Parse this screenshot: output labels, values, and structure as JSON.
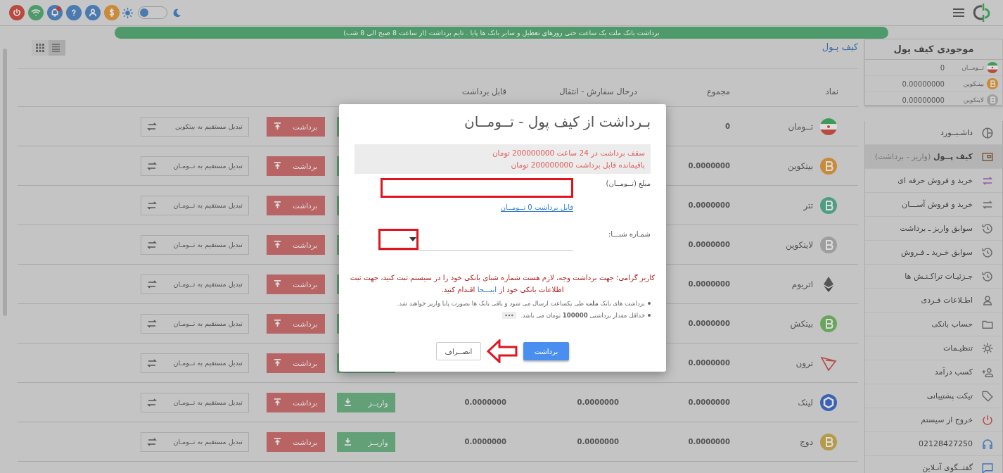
{
  "header": {
    "banner": "برداشت بانک ملت یک ساعت حتی روزهای تعطیل و سایر بانک ها پایا . تایم برداشت (از ساعت 8 صبح الی 8 شب)",
    "theme_switch": {
      "on": false
    }
  },
  "wallet_balance": {
    "title": "موجودی کیف پول",
    "rows": [
      {
        "name": "تــومــان",
        "amount": "0"
      },
      {
        "name": "بیتـکوین",
        "amount": "0.00000000"
      },
      {
        "name": "لایتکوین",
        "amount": "0.00000000"
      }
    ]
  },
  "menu": [
    {
      "label": "داشـبــورد",
      "selected": false
    },
    {
      "label": "کیف پــول",
      "note": "(واریز - برداشت)",
      "selected": true
    },
    {
      "label": "خرید و فروش حرفه ای",
      "selected": false
    },
    {
      "label": "خرید و فروش آســـان",
      "selected": false
    },
    {
      "label": "سوابق واریز ـ برداشت",
      "selected": false
    },
    {
      "label": "سوابق خـرید ـ فـروش",
      "selected": false
    },
    {
      "label": "جـزئیـات تراکـنـش ها",
      "selected": false
    },
    {
      "label": "اطـلاعات فـردی",
      "selected": false
    },
    {
      "label": "حساب بانکی",
      "selected": false
    },
    {
      "label": "تنظیـمات",
      "selected": false
    },
    {
      "label": "کسب درآمد",
      "selected": false
    },
    {
      "label": "تیکت پشتیبانی",
      "selected": false
    },
    {
      "label": "خروج از سیستم",
      "selected": false
    },
    {
      "label": "02128427250",
      "selected": false
    },
    {
      "label": "گفتــگوی آنـلاین",
      "selected": false
    }
  ],
  "page": {
    "title": "کیف پـول",
    "view_modes": [
      {
        "selected": false
      },
      {
        "selected": true
      }
    ]
  },
  "table": {
    "columns": [
      "نماد",
      "مجموع",
      "درحال سفارش - انتقال",
      "قابل برداشت"
    ],
    "rows": [
      {
        "symbol": "تــومان",
        "total": "0",
        "withdraw": "برداشت",
        "convert": "تبدیل مستقیم به بیتکوین"
      },
      {
        "symbol": "بیتکوین",
        "total": "0.0000000",
        "withdraw": "برداشت",
        "convert": "تبدیل مستقیم به تــومـان"
      },
      {
        "symbol": "تتر",
        "total": "0.0000000",
        "withdraw": "برداشت",
        "convert": "تبدیل مستقیم به تــومـان"
      },
      {
        "symbol": "لایتکوین",
        "total": "0.0000000",
        "withdraw": "برداشت",
        "convert": "تبدیل مستقیم به تــومـان"
      },
      {
        "symbol": "اتریوم",
        "total": "0.0000000",
        "withdraw": "برداشت",
        "convert": "تبدیل مستقیم به تــومـان"
      },
      {
        "symbol": "بیتکش",
        "total": "0.0000000",
        "withdraw": "برداشت",
        "convert": "تبدیل مستقیم به تــومـان"
      },
      {
        "symbol": "ترون",
        "total": "0.0000000",
        "withdraw": "برداشت",
        "convert": "تبدیل مستقیم به تــومـان"
      },
      {
        "symbol": "لینک",
        "total": "0.0000000",
        "in_order": "0.0000000",
        "withdrawable": "0.0000000",
        "deposit": "واریــز",
        "withdraw": "برداشت",
        "convert": "تبدیل مستقیم به تــومـان"
      },
      {
        "symbol": "دوج",
        "total": "0.0000000",
        "in_order": "0.0000000",
        "withdrawable": "0.0000000",
        "deposit": "واریــز",
        "withdraw": "برداشت",
        "convert": "تبدیل مستقیم به تــومـان"
      }
    ]
  },
  "modal": {
    "title": "بـرداشت از کیف پول - تــومــان",
    "limits": [
      "سقف برداشت در 24 ساعت 200000000 تومان",
      "باقیمانده قابل برداشت 200000000 تومان"
    ],
    "amount_label": "مبلغ (تــومــان)",
    "available_link": "قابل برداشت 0 تــومــان",
    "sheba_label": "شمـاره شبـــا:",
    "warning": {
      "text": "کاربر گرامی؛ جهت برداشت وجه، لازم هست شماره شبای بانکی خود را در سیستم ثبت کنید، جهت ثبت اطلاعات بانکی خود از",
      "link": "اینـــجا",
      "after": "اقـدام کنید."
    },
    "notes": [
      "برداشت های بانک **ملت** طی یکساعت ارسال می شود و باقی بانک ها بصورت پایا واریز خواهند شد.",
      "حداقل مقدار برداشتی **100000** تومان می باشد."
    ],
    "buttons": [
      {
        "label": "برداشت",
        "kind": "primary"
      },
      {
        "label": "انصــراف",
        "kind": "secondary"
      }
    ]
  }
}
